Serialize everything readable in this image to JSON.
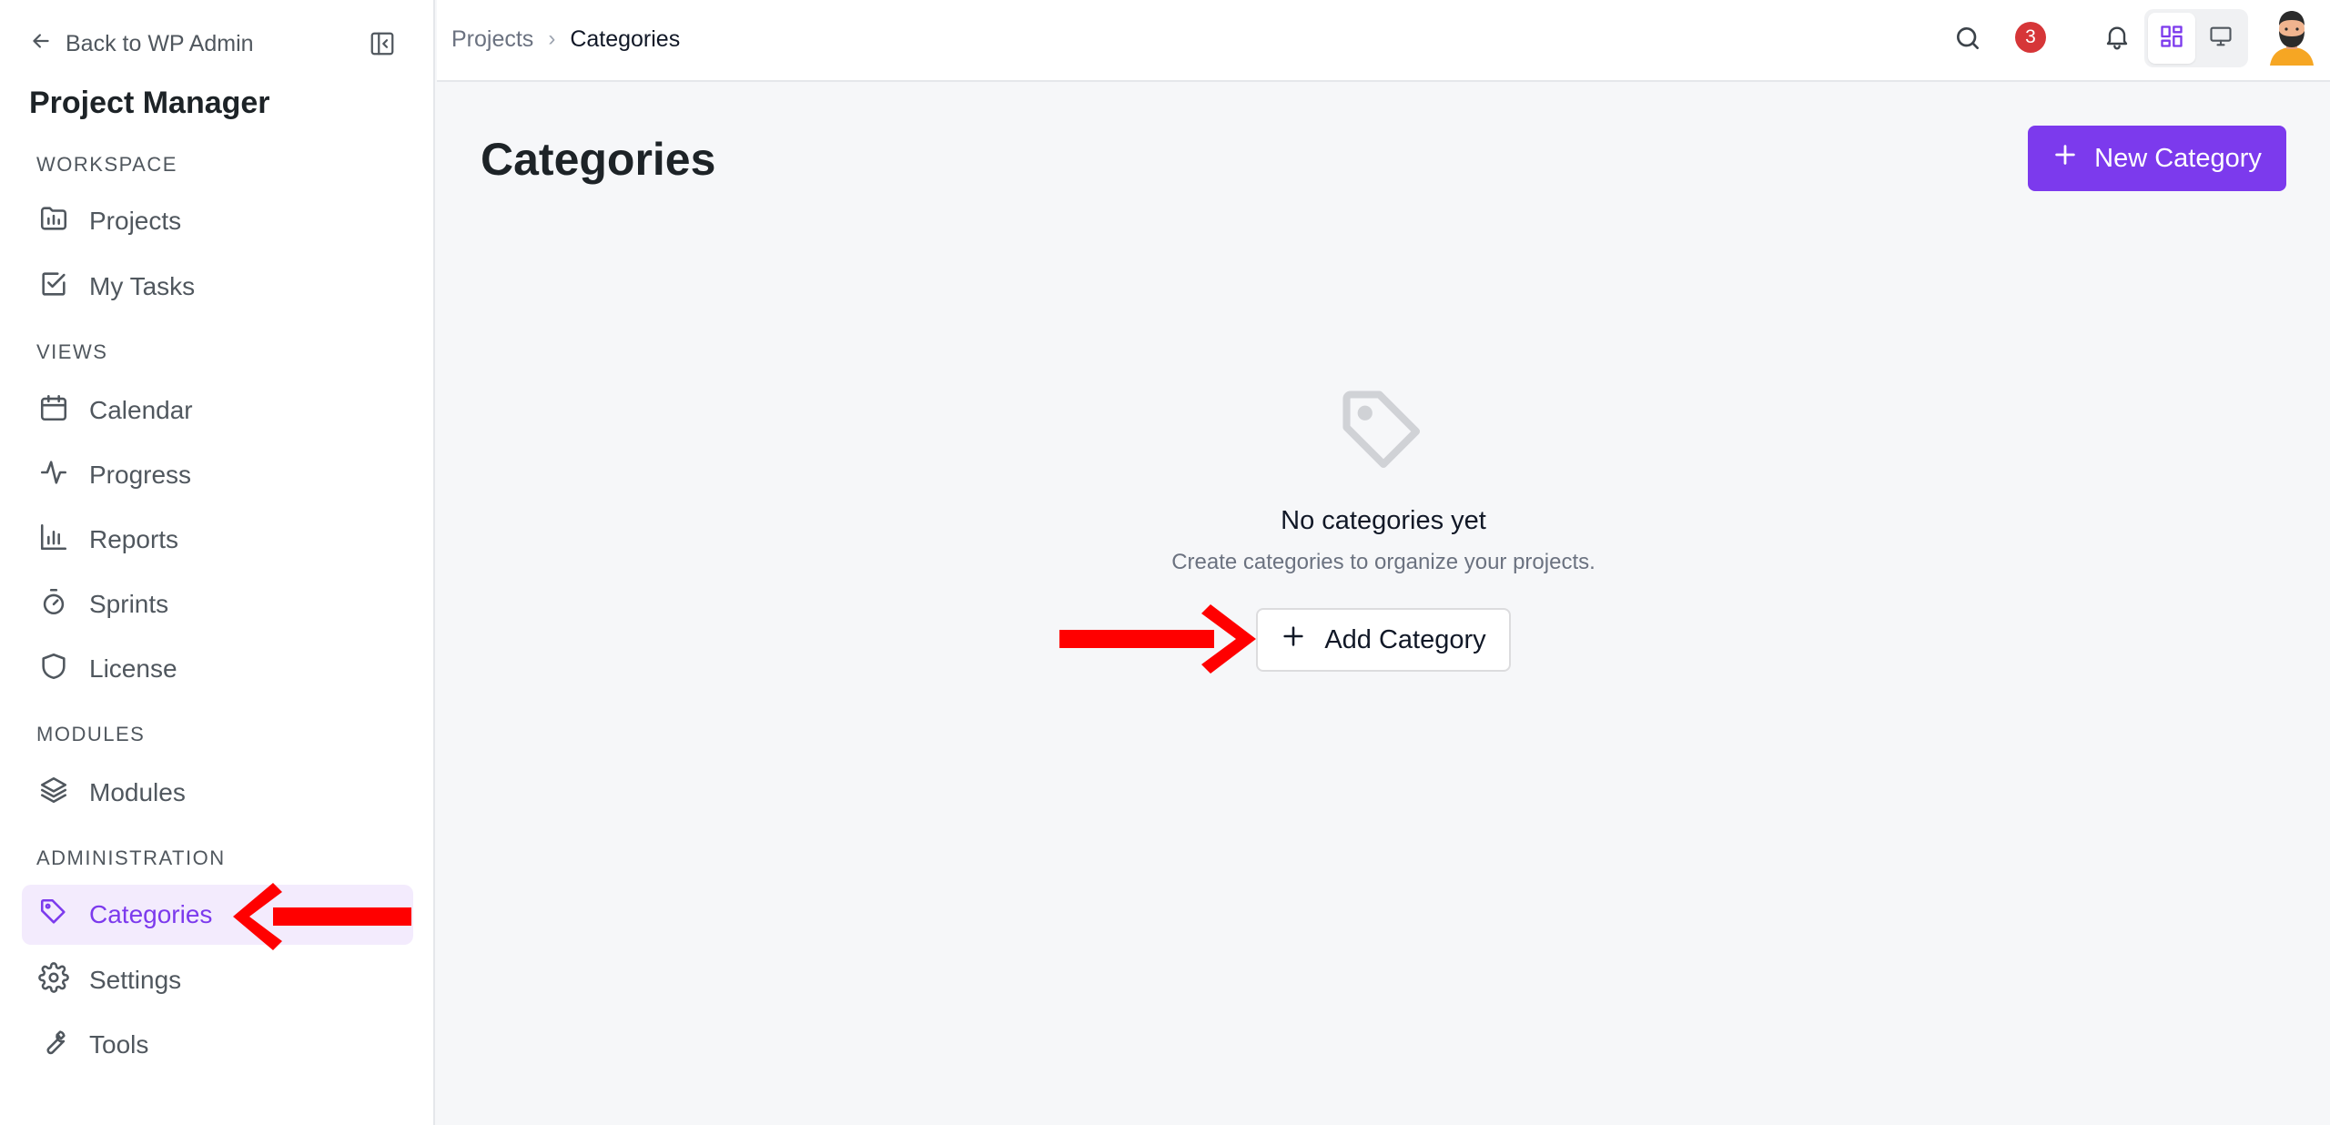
{
  "sidebar": {
    "back_label": "Back to WP Admin",
    "app_title": "Project Manager",
    "sections": {
      "workspace": "WORKSPACE",
      "views": "VIEWS",
      "modules": "MODULES",
      "administration": "ADMINISTRATION"
    },
    "items": {
      "projects": "Projects",
      "my_tasks": "My Tasks",
      "calendar": "Calendar",
      "progress": "Progress",
      "reports": "Reports",
      "sprints": "Sprints",
      "license": "License",
      "modules": "Modules",
      "categories": "Categories",
      "settings": "Settings",
      "tools": "Tools"
    },
    "active_item": "categories"
  },
  "topbar": {
    "breadcrumb": [
      "Projects",
      "Categories"
    ],
    "notification_count": "3",
    "active_view": "grid"
  },
  "main": {
    "title": "Categories",
    "new_button": "New Category",
    "empty_title": "No categories yet",
    "empty_description": "Create categories to organize your projects.",
    "add_button": "Add Category"
  },
  "colors": {
    "accent": "#7c3aed",
    "active_bg": "#f3ebfd",
    "badge": "#d63638",
    "annotation_arrow": "#ff0000"
  }
}
